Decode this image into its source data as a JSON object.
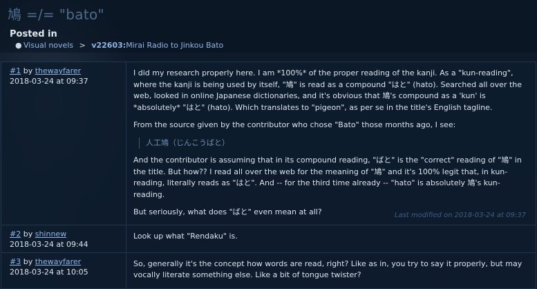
{
  "header": {
    "title": "鳩 =/= \"bato\"",
    "posted_in_label": "Posted in",
    "breadcrumb": {
      "category": "Visual novels",
      "separator": ">",
      "vn_id": "v22603",
      "vn_title": "Mirai Radio to Jinkou Bato"
    }
  },
  "posts": [
    {
      "num": "#1",
      "by": "by",
      "user": "thewayfarer",
      "date": "2018-03-24 at 09:37",
      "paragraphs": [
        "I did my research properly here. I am *100%* of the proper reading of the kanji. As a \"kun-reading\", where the kanji is being used by itself, \"鳩\" is read as a compound \"はと\" (hato). Searched all over the web, looked in online Japanese dictionaries, and it's obvious that 鳩's compound as a 'kun' is *absolutely* \"はと\" (hato). Which translates to \"pigeon\", as per se in the title's English tagline.",
        "From the source given by the contributor who chose \"Bato\" those months ago, I see:"
      ],
      "quote": "人工鳩（じんこうばと）",
      "paragraphs_after": [
        "And the contributor is assuming that in its compound reading, \"ばと\" is the \"correct\" reading of \"鳩\" in the title. But how?? I read all over the web for the meaning of \"鳩\" and it's 100% legit that, in kun-reading, literally reads as \"はと\". And -- for the third time already -- \"hato\" is absolutely 鳩's kun-reading.",
        "But seriously, what does \"ばと\" even mean at all?"
      ],
      "last_modified": "Last modified on 2018-03-24 at 09:37"
    },
    {
      "num": "#2",
      "by": "by",
      "user": "shinnew",
      "date": "2018-03-24 at 09:44",
      "text": "Look up what \"Rendaku\" is."
    },
    {
      "num": "#3",
      "by": "by",
      "user": "thewayfarer",
      "date": "2018-03-24 at 10:05",
      "text": "So, generally it's the concept how words are read, right? Like as in, you try to say it properly, but may vocally literate something else. Like a bit of tongue twister?"
    }
  ]
}
